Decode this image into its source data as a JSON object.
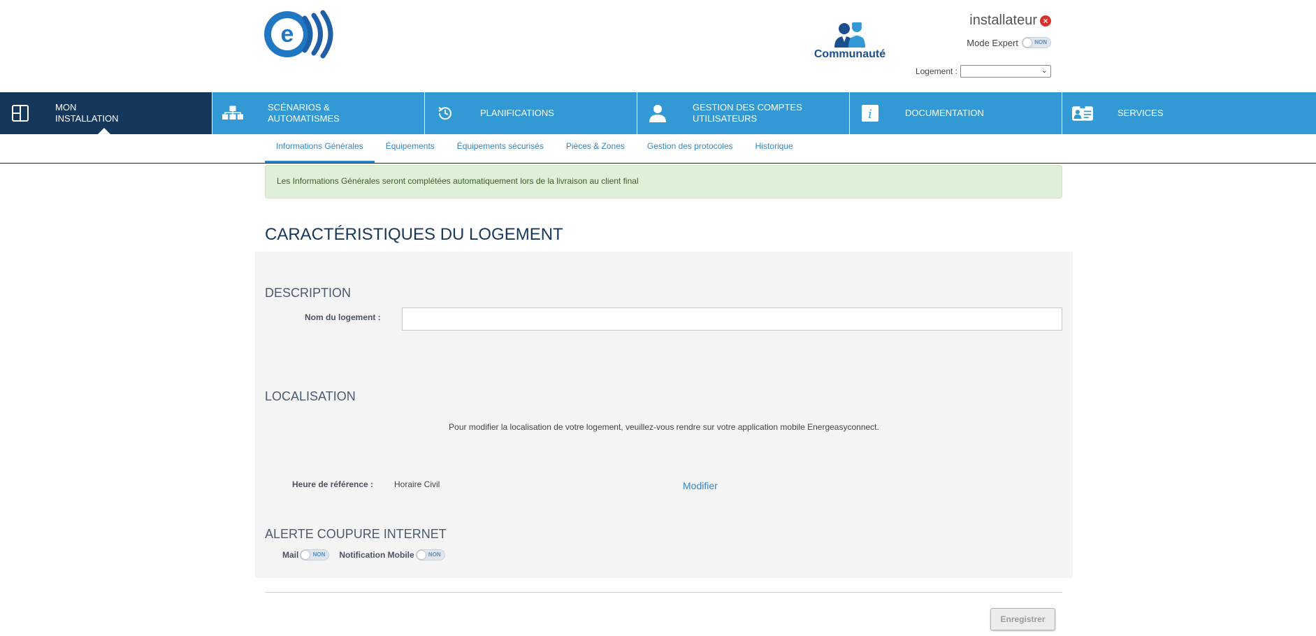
{
  "header": {
    "community_label": "Communauté",
    "username": "installateur",
    "expert_mode_label": "Mode Expert",
    "expert_mode_state": "NON",
    "logement_label": "Logement :",
    "logement_value": ""
  },
  "mainnav": {
    "items": [
      {
        "label_line1": "MON",
        "label_line2": "INSTALLATION",
        "icon": "installation-icon",
        "active": true
      },
      {
        "label_line1": "SCÉNARIOS &",
        "label_line2": "AUTOMATISMES",
        "icon": "scenarios-icon",
        "active": false
      },
      {
        "label_line1": "PLANIFICATIONS",
        "label_line2": "",
        "icon": "history-clock-icon",
        "active": false
      },
      {
        "label_line1": "GESTION DES COMPTES",
        "label_line2": "UTILISATEURS",
        "icon": "user-icon",
        "active": false
      },
      {
        "label_line1": "DOCUMENTATION",
        "label_line2": "",
        "icon": "info-icon",
        "active": false
      },
      {
        "label_line1": "SERVICES",
        "label_line2": "",
        "icon": "services-icon",
        "active": false
      }
    ]
  },
  "subnav": {
    "tabs": [
      {
        "label": "Informations Générales",
        "active": true
      },
      {
        "label": "Équipements",
        "active": false
      },
      {
        "label": "Équipements sécurisés",
        "active": false
      },
      {
        "label": "Pièces & Zones",
        "active": false
      },
      {
        "label": "Gestion des protocoles",
        "active": false
      },
      {
        "label": "Historique",
        "active": false
      }
    ]
  },
  "alert": {
    "text": "Les Informations Générales seront complétées automatiquement lors de la livraison au client final"
  },
  "page": {
    "title": "CARACTÉRISTIQUES DU LOGEMENT"
  },
  "description": {
    "title": "DESCRIPTION",
    "name_label": "Nom du logement :",
    "name_value": ""
  },
  "localisation": {
    "title": "LOCALISATION",
    "message": "Pour modifier la localisation de votre logement, veuillez-vous rendre sur votre application mobile Energeasyconnect.",
    "ref_label": "Heure de référence :",
    "ref_value": "Horaire Civil",
    "modify_label": "Modifier"
  },
  "internet_alert": {
    "title": "ALERTE COUPURE INTERNET",
    "mail_label": "Mail",
    "mail_state": "NON",
    "notif_label": "Notification Mobile",
    "notif_state": "NON"
  },
  "actions": {
    "save_label": "Enregistrer"
  },
  "colors": {
    "nav_blue": "#3399d5",
    "nav_active": "#16375c",
    "link_blue": "#2e86c7",
    "alert_green": "#dff0d8"
  }
}
